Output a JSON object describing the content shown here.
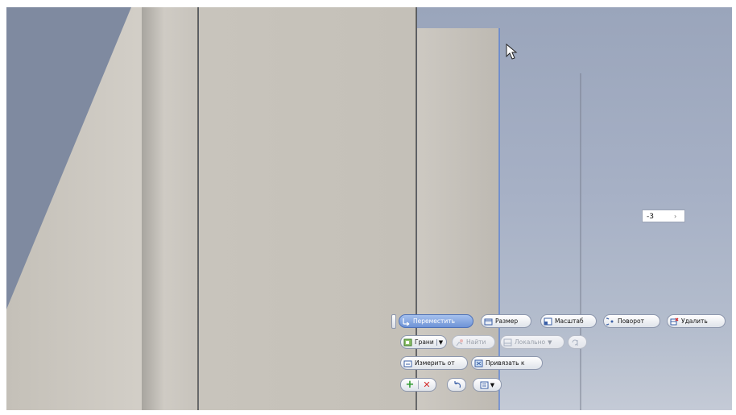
{
  "viewport": {
    "background": "#a6b0c5"
  },
  "dimension_input": {
    "value": "-3",
    "arrow": "›"
  },
  "minitoolbar": {
    "row1": [
      {
        "label": "Переместить",
        "icon": "move-icon",
        "active": true
      },
      {
        "label": "Размер",
        "icon": "resize-box-icon"
      },
      {
        "label": "Масштаб",
        "icon": "scale-icon"
      },
      {
        "label": "Поворот",
        "icon": "rotate-icon"
      },
      {
        "label": "Удалить",
        "icon": "delete-icon"
      }
    ],
    "row2": [
      {
        "label": "Грани",
        "icon": "faces-icon"
      },
      {
        "label": "Найти",
        "icon": "find-icon",
        "disabled": true
      },
      {
        "label": "Локально",
        "icon": "local-icon",
        "disabled": true
      }
    ],
    "row3": [
      {
        "label": "Измерить от",
        "icon": "measure-icon"
      },
      {
        "label": "Привязать к",
        "icon": "snap-icon"
      }
    ],
    "row4": [
      {
        "name": "apply",
        "icon": "plus-icon",
        "color": "#2e9a2e"
      },
      {
        "name": "cancel",
        "icon": "x-icon",
        "color": "#d42a2a"
      },
      {
        "name": "undo",
        "icon": "undo-icon"
      },
      {
        "name": "options",
        "icon": "list-dropdown-icon"
      }
    ]
  }
}
